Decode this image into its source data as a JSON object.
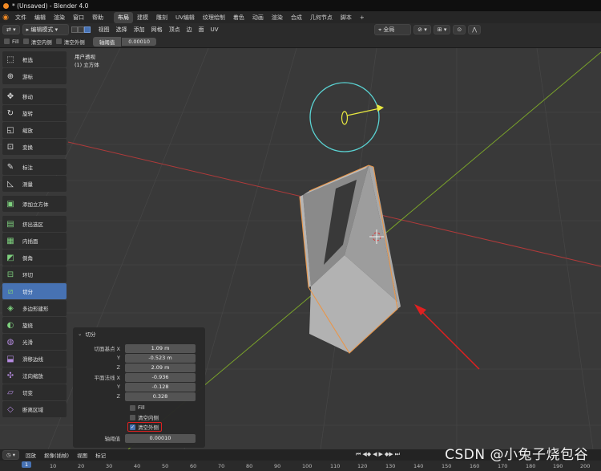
{
  "window": {
    "title": "* (Unsaved) - Blender 4.0"
  },
  "menu": {
    "items": [
      "文件",
      "编辑",
      "渲染",
      "窗口",
      "帮助"
    ]
  },
  "workspaces": [
    "布局",
    "建模",
    "雕刻",
    "UV编辑",
    "纹理绘制",
    "着色",
    "动画",
    "渲染",
    "合成",
    "几何节点",
    "脚本"
  ],
  "workspace_add": "+",
  "header": {
    "mode": "编辑模式",
    "items": [
      "视图",
      "选择",
      "添加",
      "网格",
      "顶点",
      "边",
      "面",
      "UV"
    ],
    "orientation": "全局"
  },
  "options_bar": {
    "fill_label": "Fill",
    "clear_inner_label": "清空内侧",
    "clear_outer_label": "清空外侧",
    "threshold_label": "轴阈值",
    "threshold_value": "0.00010"
  },
  "viewport": {
    "view_name": "用户透视",
    "object_name": "(1) 立方体"
  },
  "tools": [
    {
      "label": "框选",
      "icon": "select-box-icon"
    },
    {
      "label": "游标",
      "icon": "cursor-icon"
    },
    {
      "label": "移动",
      "icon": "move-icon"
    },
    {
      "label": "旋转",
      "icon": "rotate-icon"
    },
    {
      "label": "缩放",
      "icon": "scale-icon"
    },
    {
      "label": "变换",
      "icon": "transform-icon"
    },
    {
      "label": "标注",
      "icon": "annotate-icon"
    },
    {
      "label": "测量",
      "icon": "measure-icon"
    },
    {
      "label": "添加立方体",
      "icon": "add-cube-icon"
    },
    {
      "label": "挤出选区",
      "icon": "extrude-icon"
    },
    {
      "label": "内插面",
      "icon": "inset-icon"
    },
    {
      "label": "倒角",
      "icon": "bevel-icon"
    },
    {
      "label": "环切",
      "icon": "loop-cut-icon"
    },
    {
      "label": "切分",
      "icon": "bisect-icon"
    },
    {
      "label": "多边形建形",
      "icon": "poly-build-icon"
    },
    {
      "label": "旋绕",
      "icon": "spin-icon"
    },
    {
      "label": "光滑",
      "icon": "smooth-icon"
    },
    {
      "label": "滑移边线",
      "icon": "edge-slide-icon"
    },
    {
      "label": "法向缩放",
      "icon": "shrink-fatten-icon"
    },
    {
      "label": "切变",
      "icon": "shear-icon"
    },
    {
      "label": "断离区域",
      "icon": "rip-region-icon"
    }
  ],
  "operator_panel": {
    "title": "切分",
    "plane_point_label": "切面基点 X",
    "plane_point": [
      "1.09 m",
      "-0.523 m",
      "2.09 m"
    ],
    "plane_normal_label": "平面法线 X",
    "plane_normal": [
      "-0.936",
      "-0.128",
      "0.328"
    ],
    "axis_y": "Y",
    "axis_z": "Z",
    "fill_label": "Fill",
    "clear_inner_label": "清空内侧",
    "clear_outer_label": "清空外侧",
    "threshold_label": "轴阈值",
    "threshold_value": "0.00010"
  },
  "timeline": {
    "menu": [
      "回放",
      "抠像(插帧)",
      "视图",
      "标记"
    ],
    "current_frame": "1",
    "frames": [
      "10",
      "20",
      "30",
      "40",
      "50",
      "60",
      "70",
      "80",
      "90",
      "100",
      "110",
      "120",
      "130",
      "140",
      "150",
      "160",
      "170",
      "180",
      "190",
      "200"
    ]
  },
  "watermark": "CSDN @小兔子烧包谷",
  "colors": {
    "accent": "#4772b3",
    "highlight_box": "#e02020",
    "arrow": "#e02020",
    "x_axis": "#b03a3a",
    "y_axis": "#7aa32a",
    "light_ring": "#5ad3d3",
    "light_arrow": "#e8e840",
    "mesh_edge": "#e8964a"
  }
}
